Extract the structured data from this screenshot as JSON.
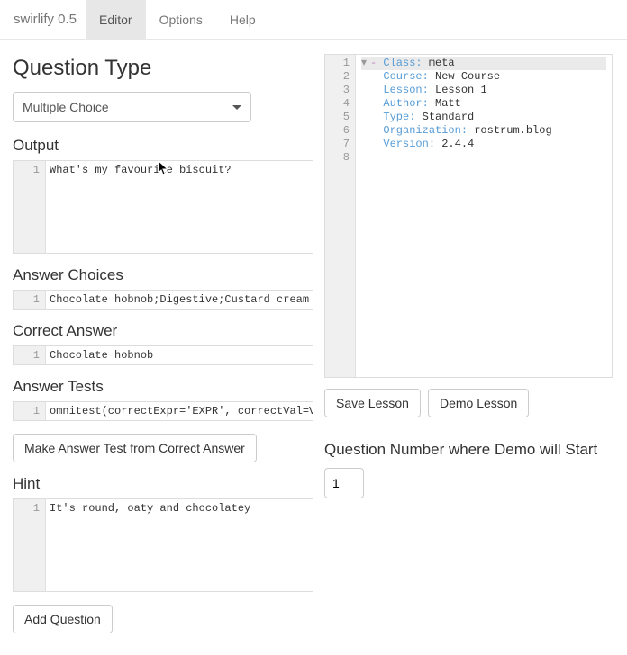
{
  "nav": {
    "brand": "swirlify 0.5",
    "items": [
      "Editor",
      "Options",
      "Help"
    ],
    "active_index": 0
  },
  "left": {
    "title": "Question Type",
    "dropdown_value": "Multiple Choice",
    "output_label": "Output",
    "output_value": "What's my favourite biscuit?",
    "choices_label": "Answer Choices",
    "choices_value": "Chocolate hobnob;Digestive;Custard cream",
    "correct_label": "Correct Answer",
    "correct_value": "Chocolate hobnob",
    "tests_label": "Answer Tests",
    "tests_value": "omnitest(correctExpr='EXPR', correctVal=VAL)",
    "make_test_btn": "Make Answer Test from Correct Answer",
    "hint_label": "Hint",
    "hint_value": "It's round, oaty and chocolatey",
    "add_q_btn": "Add Question"
  },
  "right": {
    "yaml_lines": [
      {
        "n": 1,
        "prefix": "- ",
        "key": "Class:",
        "val": " meta",
        "fold": true
      },
      {
        "n": 2,
        "prefix": "  ",
        "key": "Course:",
        "val": " New Course"
      },
      {
        "n": 3,
        "prefix": "  ",
        "key": "Lesson:",
        "val": " Lesson 1"
      },
      {
        "n": 4,
        "prefix": "  ",
        "key": "Author:",
        "val": " Matt"
      },
      {
        "n": 5,
        "prefix": "  ",
        "key": "Type:",
        "val": " Standard"
      },
      {
        "n": 6,
        "prefix": "  ",
        "key": "Organization:",
        "val": " rostrum.blog"
      },
      {
        "n": 7,
        "prefix": "  ",
        "key": "Version:",
        "val": " 2.4.4"
      },
      {
        "n": 8,
        "prefix": "",
        "key": "",
        "val": ""
      }
    ],
    "save_btn": "Save Lesson",
    "demo_btn": "Demo Lesson",
    "q_num_label": "Question Number where Demo will Start",
    "q_num_value": "1"
  }
}
